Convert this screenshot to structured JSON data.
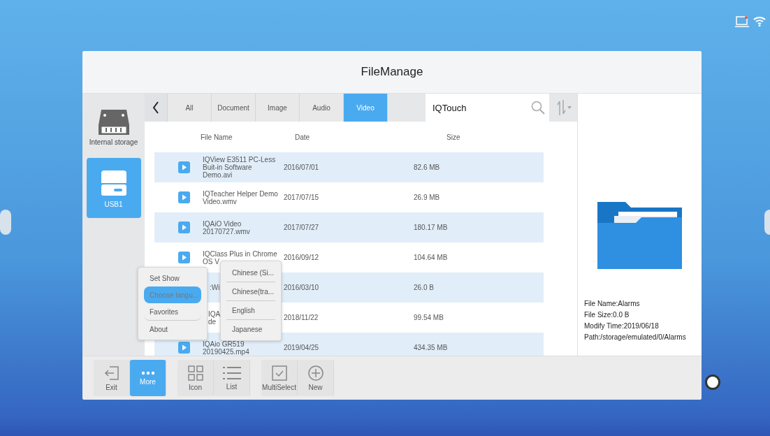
{
  "window_title": "FileManage",
  "sidebar": {
    "items": [
      {
        "label": "Internal storage",
        "kind": "drive",
        "selected": false
      },
      {
        "label": "USB1",
        "kind": "usb",
        "selected": true
      }
    ]
  },
  "tabs": [
    {
      "label": "All",
      "selected": false
    },
    {
      "label": "Document",
      "selected": false
    },
    {
      "label": "Image",
      "selected": false
    },
    {
      "label": "Audio",
      "selected": false
    },
    {
      "label": "Video",
      "selected": true
    }
  ],
  "search": {
    "value": "IQTouch"
  },
  "columns": [
    "File Name",
    "Date",
    "Size"
  ],
  "rows": [
    {
      "name": "IQView E3511 PC-Less Buit-in Software Demo.avi",
      "date": "2016/07/01",
      "size": "82.6 MB"
    },
    {
      "name": "IQTeacher Helper Demo Video.wmv",
      "date": "2017/07/15",
      "size": "26.9 MB"
    },
    {
      "name": "IQAiO Video 20170727.wmv",
      "date": "2017/07/27",
      "size": "180.17 MB"
    },
    {
      "name": "IQClass Plus in Chrome OS V",
      "date": "2016/09/12",
      "size": "104.64 MB"
    },
    {
      "name": ":Wi",
      "date": "2016/03/10",
      "size": "26.0 B"
    },
    {
      "name": "IQA\nde",
      "date": "2018/11/22",
      "size": "99.54 MB"
    },
    {
      "name": "IQAio GR519 20190425.mp4",
      "date": "2019/04/25",
      "size": "434.35 MB"
    }
  ],
  "details": [
    "File Name:Alarms",
    "File Size:0.0 B",
    "Modify Time:2019/06/18",
    "Path:/storage/emulated/0/Alarms"
  ],
  "toolbar": [
    [
      {
        "label": "Exit",
        "kind": "exit",
        "selected": false
      },
      {
        "label": "More",
        "kind": "more",
        "selected": true
      }
    ],
    [
      {
        "label": "Icon",
        "kind": "grid",
        "selected": false
      },
      {
        "label": "List",
        "kind": "list",
        "selected": false
      }
    ],
    [
      {
        "label": "MultiSelect",
        "kind": "check",
        "selected": false
      },
      {
        "label": "New",
        "kind": "plus",
        "selected": false
      }
    ]
  ],
  "more_menu": {
    "items": [
      {
        "label": "Set Show",
        "selected": false
      },
      {
        "label": "Choose langu...",
        "selected": true
      },
      {
        "label": "Favorites",
        "selected": false
      },
      {
        "label": "About",
        "selected": false
      }
    ]
  },
  "language_menu": {
    "items": [
      "Chinese (Si...",
      "Chinese(tra...",
      "English",
      "Japanese"
    ]
  }
}
